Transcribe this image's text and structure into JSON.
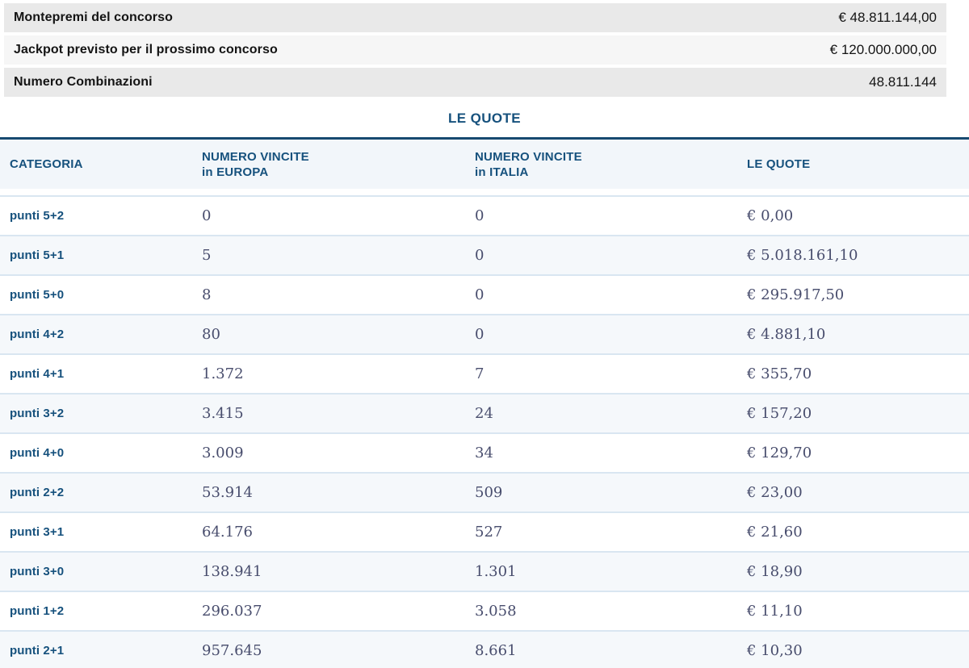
{
  "info_rows": [
    {
      "label": "Montepremi del concorso",
      "value": "€ 48.811.144,00"
    },
    {
      "label": "Jackpot previsto per il prossimo concorso",
      "value": "€ 120.000.000,00"
    },
    {
      "label": "Numero Combinazioni",
      "value": "48.811.144"
    }
  ],
  "section_title": "LE QUOTE",
  "table": {
    "headers": {
      "categoria": "CATEGORIA",
      "europa_line1": "NUMERO VINCITE",
      "europa_line2": "in EUROPA",
      "italia_line1": "NUMERO VINCITE",
      "italia_line2": "in ITALIA",
      "quote": "LE QUOTE"
    },
    "rows": [
      {
        "categoria": "punti 5+2",
        "europa": "0",
        "italia": "0",
        "quota": "€ 0,00"
      },
      {
        "categoria": "punti 5+1",
        "europa": "5",
        "italia": "0",
        "quota": "€ 5.018.161,10"
      },
      {
        "categoria": "punti 5+0",
        "europa": "8",
        "italia": "0",
        "quota": "€ 295.917,50"
      },
      {
        "categoria": "punti 4+2",
        "europa": "80",
        "italia": "0",
        "quota": "€ 4.881,10"
      },
      {
        "categoria": "punti 4+1",
        "europa": "1.372",
        "italia": "7",
        "quota": "€ 355,70"
      },
      {
        "categoria": "punti 3+2",
        "europa": "3.415",
        "italia": "24",
        "quota": "€ 157,20"
      },
      {
        "categoria": "punti 4+0",
        "europa": "3.009",
        "italia": "34",
        "quota": "€ 129,70"
      },
      {
        "categoria": "punti 2+2",
        "europa": "53.914",
        "italia": "509",
        "quota": "€ 23,00"
      },
      {
        "categoria": "punti 3+1",
        "europa": "64.176",
        "italia": "527",
        "quota": "€ 21,60"
      },
      {
        "categoria": "punti 3+0",
        "europa": "138.941",
        "italia": "1.301",
        "quota": "€ 18,90"
      },
      {
        "categoria": "punti 1+2",
        "europa": "296.037",
        "italia": "3.058",
        "quota": "€ 11,10"
      },
      {
        "categoria": "punti 2+1",
        "europa": "957.645",
        "italia": "8.661",
        "quota": "€ 10,30"
      }
    ]
  },
  "colors": {
    "accent_blue": "#16517d",
    "table_top_border": "#174a70",
    "row_separator": "#d9e6f1",
    "alt_row_bg": "#f5f8fb",
    "header_bg": "#f2f6fa",
    "info_bar_dark": "#e9e9e9",
    "info_bar_light": "#f6f6f6",
    "figure_text": "#484d6d"
  }
}
